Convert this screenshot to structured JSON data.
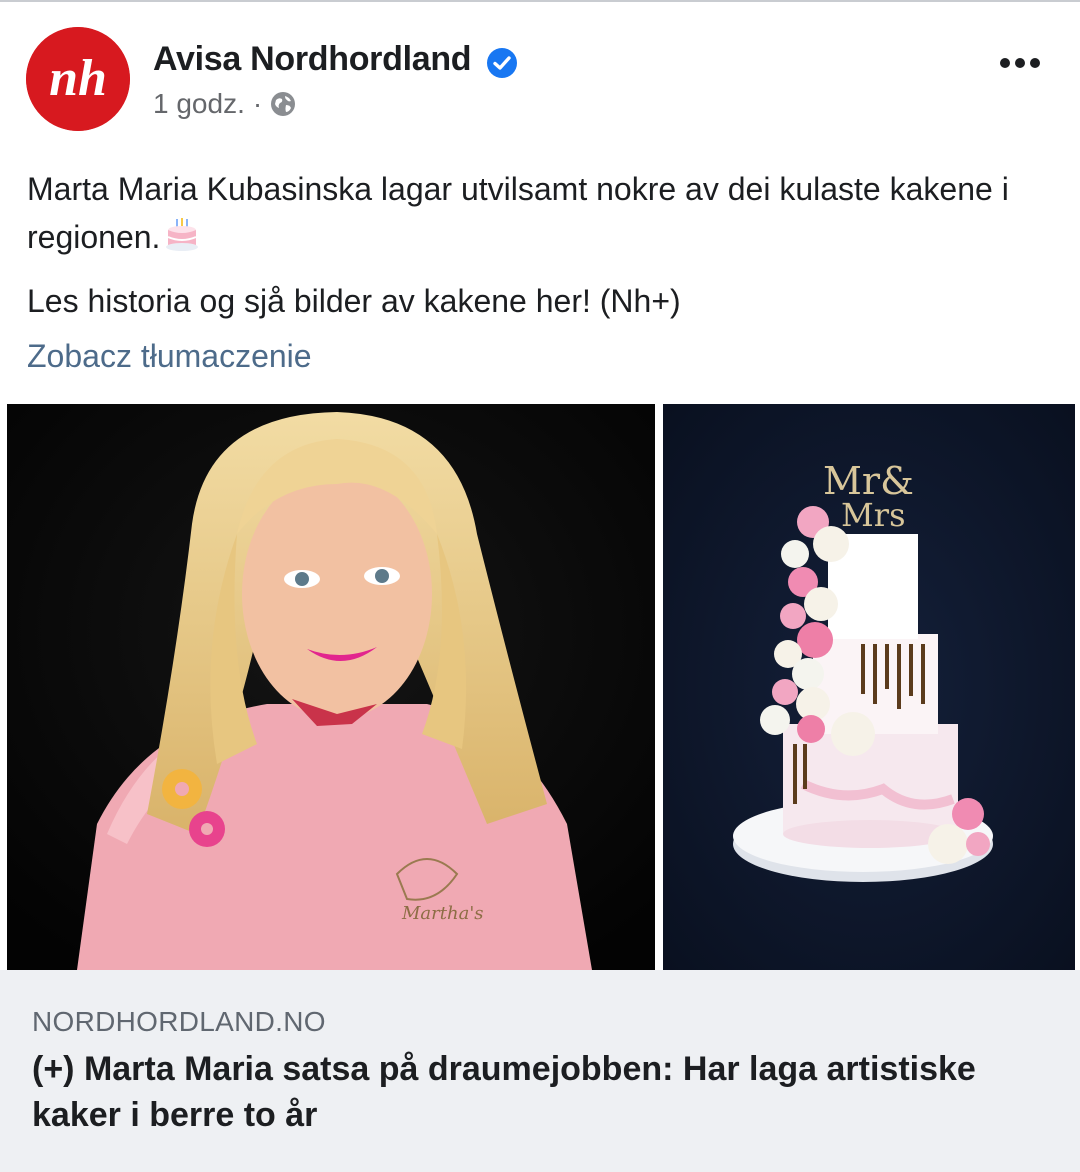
{
  "post": {
    "author": "Avisa Nordhordland",
    "time": "1 godz.",
    "separator": "·",
    "paragraphs": [
      "Marta Maria Kubasinska lagar utvilsamt nokre av dei kulaste kakene i regionen.",
      "Les historia og sjå bilder av kakene her! (Nh+)"
    ],
    "translate_link": "Zobacz tłumaczenie"
  },
  "icons": {
    "avatar": "nh-logo",
    "verified": "verified-badge-icon",
    "audience": "globe-icon",
    "more": "more-options-icon",
    "emoji": "birthday-cake-emoji"
  },
  "link_preview": {
    "domain": "NORDHORDLAND.NO",
    "title": "(+) Marta Maria satsa på draumejobben: Har laga artistiske kaker i berre to år"
  },
  "colors": {
    "brand_red": "#d7191f",
    "verified_blue": "#1877f2",
    "link_color": "#4d6b8a",
    "card_bg": "#eef0f3"
  }
}
